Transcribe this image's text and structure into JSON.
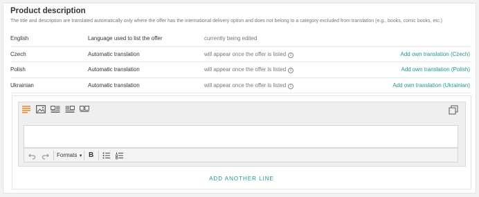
{
  "section": {
    "title": "Product description",
    "subtitle": "The title and description are translated automatically only where the offer has the international delivery option and does not belong to a category excluded from translation (e.g., books, comic books, etc.)"
  },
  "languages": [
    {
      "language": "English",
      "mode": "Language used to list the offer",
      "status": "currently being edited",
      "info": false,
      "action": ""
    },
    {
      "language": "Czech",
      "mode": "Automatic translation",
      "status": "will appear once the offer is listed",
      "info": true,
      "action": "Add own translation (Czech)"
    },
    {
      "language": "Polish",
      "mode": "Automatic translation",
      "status": "will appear once the offer is listed",
      "info": true,
      "action": "Add own translation (Polish)"
    },
    {
      "language": "Ukrainian",
      "mode": "Automatic translation",
      "status": "will appear once the offer is listed",
      "info": true,
      "action": "Add own translation (Ukrainian)"
    }
  ],
  "editor": {
    "block_icons": [
      "text-block-icon",
      "image-block-icon",
      "image-text-block-icon",
      "text-image-block-icon",
      "two-images-block-icon"
    ],
    "copy_icon": "copy-icon",
    "toolbar": {
      "undo_icon": "undo-icon",
      "redo_icon": "redo-icon",
      "formats_label": "Formats",
      "bold_label": "B",
      "bullet_list_icon": "bullet-list-icon",
      "numbered_list_icon": "numbered-list-icon"
    },
    "add_line_label": "ADD ANOTHER LINE"
  },
  "colors": {
    "accent": "#1c9a8e",
    "active_block": "#f08c30"
  }
}
